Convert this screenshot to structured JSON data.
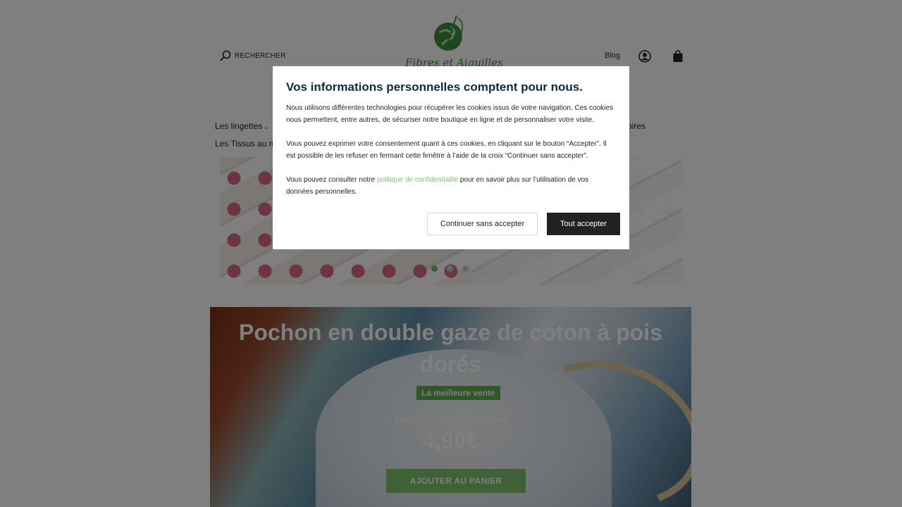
{
  "header": {
    "search_label": "RECHERCHER",
    "logo_text": "Fibres et Aiguilles",
    "blog_label": "Blog"
  },
  "nav": {
    "item_1": "Les lingettes",
    "item_2": "Les Tissus au m",
    "item_3_partial": "ssoires"
  },
  "slider": {
    "slide_count": 3,
    "active_index": 0
  },
  "product": {
    "title": "Pochon en double gaze de coton à pois dorés",
    "badge": "La meilleure vente",
    "availability": "Disponible en 7 formats et 19 coloris",
    "price": "4,90€",
    "add_to_cart": "AJOUTER AU PANIER"
  },
  "cookie_modal": {
    "title": "Vos informations personnelles comptent pour nous.",
    "paragraph_1": "Nous utilisons différentes technologies pour récupérer les cookies issus de votre navigation. Ces cookies nous permettent, entre autres, de sécuriser notre boutique en ligne et de personnaliser votre visite.",
    "paragraph_2": "Vous pouvez exprimer votre consentement quant à ces cookies, en cliquant sur le bouton “Accepter”. Il est possible de les refuser en fermant cette fenêtre à l’aide de la croix “Continuer sans accepter”.",
    "paragraph_3_before": "Vous pouvez consulter notre ",
    "paragraph_3_link": "politique de confidentialité",
    "paragraph_3_after": " pour en savoir plus sur l’utilisation de vos données personnelles.",
    "continue_label": "Continuer sans accepter",
    "accept_label": "Tout accepter"
  },
  "colors": {
    "accent_green": "#7ec46b",
    "badge_green": "#5fb04f",
    "dark_button": "#222222",
    "overlay": "rgba(0,0,0,0.5)"
  },
  "icons": [
    "search-icon",
    "account-icon",
    "cart-icon",
    "logo-globe-icon"
  ]
}
